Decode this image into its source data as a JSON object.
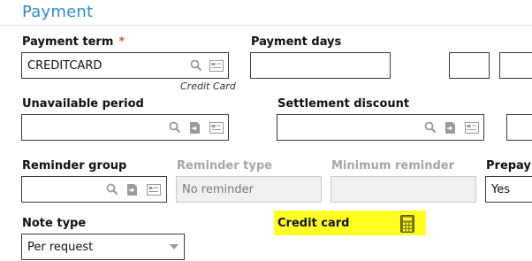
{
  "section": {
    "title": "Payment"
  },
  "payment_term": {
    "label": "Payment term",
    "required": "*",
    "value": "CREDITCARD",
    "hint": "Credit Card"
  },
  "payment_days": {
    "label": "Payment days",
    "value": ""
  },
  "unavailable_period": {
    "label": "Unavailable period",
    "value": ""
  },
  "settlement_discount": {
    "label": "Settlement discount",
    "value": ""
  },
  "reminder_group": {
    "label": "Reminder group",
    "value": ""
  },
  "reminder_type": {
    "label": "Reminder type",
    "value": "No reminder"
  },
  "minimum_reminder": {
    "label": "Minimum reminder",
    "value": ""
  },
  "prepayment": {
    "label": "Prepaym",
    "value": "Yes"
  },
  "note_type": {
    "label": "Note type",
    "value": "Per request"
  },
  "credit_card": {
    "label": "Credit card"
  },
  "colors": {
    "accent": "#2f8bd1",
    "required": "#e05a2a",
    "highlight": "#ffff22"
  }
}
